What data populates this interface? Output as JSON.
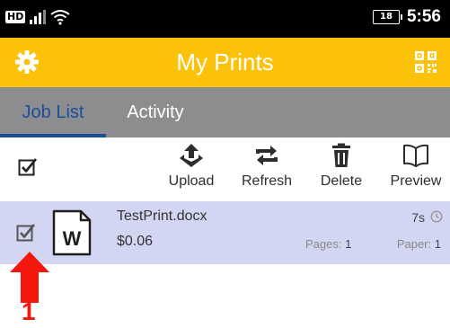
{
  "status_bar": {
    "network_badge": "HD",
    "battery_level": "18",
    "time": "5:56"
  },
  "app_bar": {
    "title": "My Prints",
    "left_icon": "gear-icon",
    "right_icon": "qr-code-icon"
  },
  "tabs": [
    {
      "label": "Job List",
      "active": true
    },
    {
      "label": "Activity",
      "active": false
    }
  ],
  "toolbar": {
    "select_all_checked": true,
    "actions": [
      {
        "label": "Upload",
        "icon": "upload-icon"
      },
      {
        "label": "Refresh",
        "icon": "refresh-icon"
      },
      {
        "label": "Delete",
        "icon": "trash-icon"
      },
      {
        "label": "Preview",
        "icon": "book-icon"
      }
    ]
  },
  "jobs": [
    {
      "name": "TestPrint.docx",
      "price": "$0.06",
      "time": "7s",
      "pages_label": "Pages:",
      "pages": "1",
      "paper_label": "Paper:",
      "paper": "1",
      "checked": true,
      "icon": "word-document-icon"
    }
  ],
  "annotation": {
    "number": "1"
  },
  "colors": {
    "app_bar": "#fcc20a",
    "tab_bar": "#8c8d8f",
    "tab_active": "#1c4d9b",
    "selected_row": "#d3d6f2",
    "annotation": "#f4170d"
  }
}
